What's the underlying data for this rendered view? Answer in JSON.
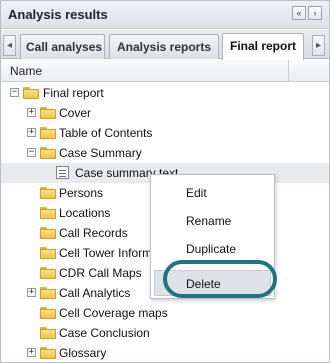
{
  "window": {
    "title": "Analysis results",
    "buttons": [
      "«",
      "›"
    ]
  },
  "tabs": {
    "scroll_left": "◂",
    "scroll_right": "▸",
    "items": [
      {
        "label": "Call analyses"
      },
      {
        "label": "Analysis reports"
      },
      {
        "label": "Final report"
      }
    ],
    "active": "Final report"
  },
  "tree": {
    "column_header": "Name",
    "items": [
      {
        "label": "Final report",
        "expander": "−",
        "icon": "folder-icon"
      },
      {
        "label": "Cover",
        "expander": "+",
        "icon": "folder-icon"
      },
      {
        "label": "Table of Contents",
        "expander": "+",
        "icon": "folder-icon"
      },
      {
        "label": "Case Summary",
        "expander": "−",
        "icon": "folder-icon"
      },
      {
        "label": "Case summary text",
        "expander": "",
        "icon": "document-icon"
      },
      {
        "label": "Persons",
        "expander": "",
        "icon": "folder-icon"
      },
      {
        "label": "Locations",
        "expander": "",
        "icon": "folder-icon"
      },
      {
        "label": "Call Records",
        "expander": "",
        "icon": "folder-icon"
      },
      {
        "label": "Cell Tower Informa",
        "expander": "",
        "icon": "folder-icon"
      },
      {
        "label": "CDR Call Maps",
        "expander": "",
        "icon": "folder-icon"
      },
      {
        "label": "Call Analytics",
        "expander": "+",
        "icon": "folder-icon"
      },
      {
        "label": "Cell Coverage maps",
        "expander": "",
        "icon": "folder-icon"
      },
      {
        "label": "Case Conclusion",
        "expander": "",
        "icon": "folder-icon"
      },
      {
        "label": "Glossary",
        "expander": "+",
        "icon": "folder-icon"
      }
    ]
  },
  "context_menu": {
    "items": [
      {
        "label": "Edit"
      },
      {
        "label": "Rename"
      },
      {
        "label": "Duplicate"
      },
      {
        "label": "Delete"
      }
    ]
  },
  "colors": {
    "highlight_ring": "#227382",
    "folder": "#f2c24a"
  }
}
